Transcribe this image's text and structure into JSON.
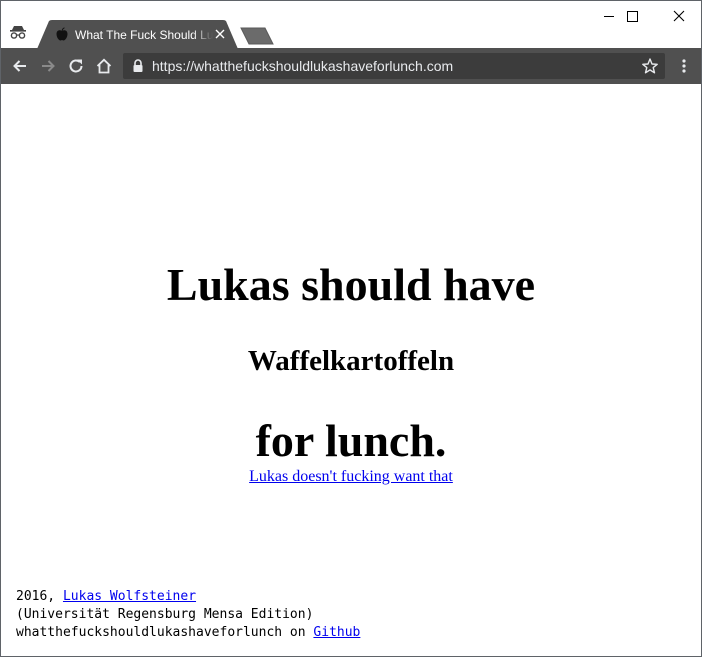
{
  "browser": {
    "tab": {
      "title": "What The Fuck Should Lukas Have For Lunch",
      "close_icon": "close-icon",
      "favicon": "apple-icon"
    },
    "toolbar": {
      "url": "https://whatthefuckshouldlukashaveforlunch.com",
      "icons": [
        "back-icon",
        "forward-icon",
        "reload-icon",
        "home-icon",
        "lock-icon",
        "star-icon",
        "menu-icon"
      ]
    },
    "window_controls": [
      "minimize-icon",
      "maximize-icon",
      "close-icon"
    ]
  },
  "content": {
    "headline": "Lukas should have",
    "food": "Waffelkartoffeln",
    "suffix": "for lunch.",
    "reject_link": "Lukas doesn't fucking want that"
  },
  "footer": {
    "year_prefix": "2016, ",
    "author": "Lukas Wolfsteiner",
    "edition": "(Universität Regensburg Mensa Edition)",
    "repo_prefix": "whatthefuckshouldlukashaveforlunch on ",
    "repo_link": "Github"
  },
  "colors": {
    "tab_active": "#505050",
    "toolbar": "#505050",
    "omnibox": "#3c3c3c",
    "link": "#0000ee"
  }
}
